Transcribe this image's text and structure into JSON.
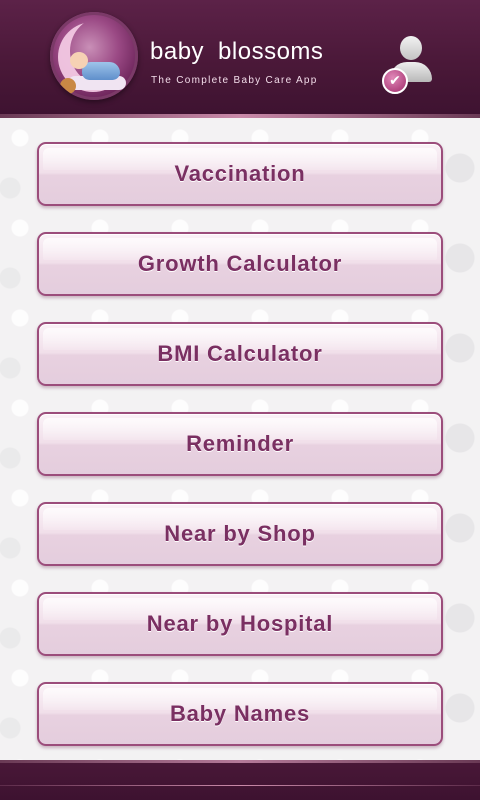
{
  "header": {
    "app_name_part1": "baby",
    "app_name_part2": "blossoms",
    "tagline": "The Complete Baby Care App",
    "logo_icon": "baby-sleeping-on-moon-logo",
    "profile_icon": "user-check-icon",
    "profile_check_glyph": "✔"
  },
  "menu": {
    "items": [
      {
        "label": "Vaccination"
      },
      {
        "label": "Growth Calculator"
      },
      {
        "label": "BMI Calculator"
      },
      {
        "label": "Reminder"
      },
      {
        "label": "Near by Shop"
      },
      {
        "label": "Near by Hospital"
      },
      {
        "label": "Baby Names"
      }
    ]
  },
  "colors": {
    "header_bg": "#4a1838",
    "button_text": "#7a2f62",
    "button_border": "#9b4d7b",
    "content_bg": "#f3f2f3"
  }
}
